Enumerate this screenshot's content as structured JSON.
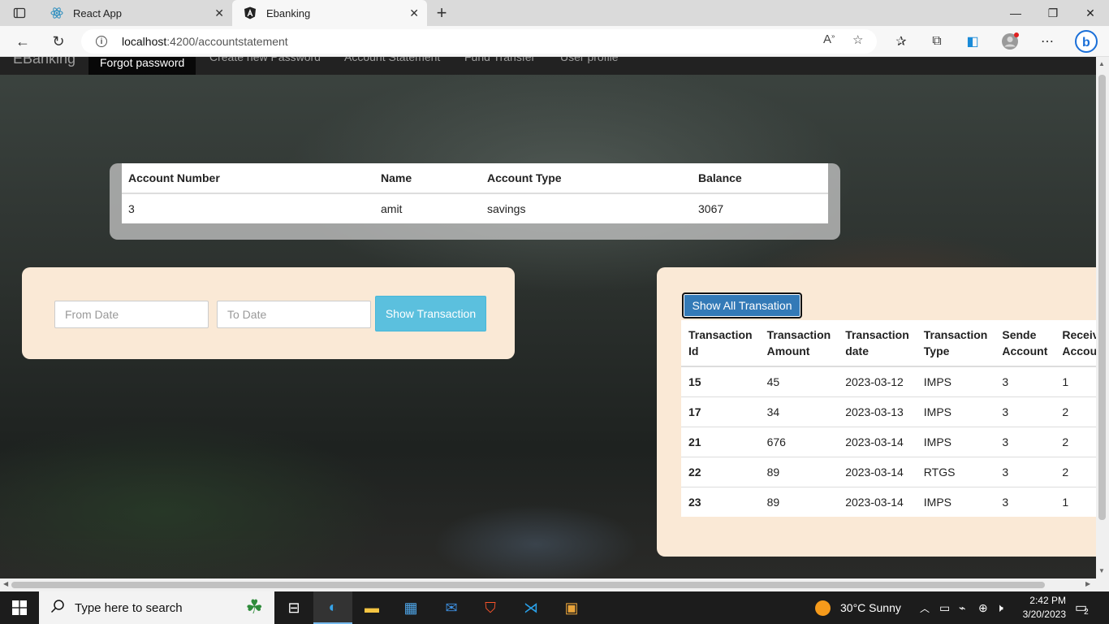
{
  "browser": {
    "tabs": [
      {
        "title": "React App",
        "icon": "react-icon",
        "active": false
      },
      {
        "title": "Ebanking",
        "icon": "angular-icon",
        "active": true
      }
    ],
    "url_host": "localhost",
    "url_path": ":4200/accountstatement"
  },
  "navbar": {
    "brand": "EBanking",
    "items": [
      "Forgot password",
      "Create new Password",
      "Account Statement",
      "Fund Transfer",
      "User profile"
    ]
  },
  "account": {
    "headers": [
      "Account Number",
      "Name",
      "Account Type",
      "Balance"
    ],
    "row": [
      "3",
      "amit",
      "savings",
      "3067"
    ]
  },
  "filter": {
    "from_placeholder": "From Date",
    "to_placeholder": "To Date",
    "show_label": "Show Transaction"
  },
  "transactions": {
    "show_all_label": "Show All Transation",
    "headers": [
      [
        "Transaction",
        "Id"
      ],
      [
        "Transaction",
        "Amount"
      ],
      [
        "Transaction",
        "date"
      ],
      [
        "Transaction",
        "Type"
      ],
      [
        "Sende",
        "Account"
      ],
      [
        "Receive",
        "Accoun"
      ]
    ],
    "rows": [
      [
        "15",
        "45",
        "2023-03-12",
        "IMPS",
        "3",
        "1"
      ],
      [
        "17",
        "34",
        "2023-03-13",
        "IMPS",
        "3",
        "2"
      ],
      [
        "21",
        "676",
        "2023-03-14",
        "IMPS",
        "3",
        "2"
      ],
      [
        "22",
        "89",
        "2023-03-14",
        "RTGS",
        "3",
        "2"
      ],
      [
        "23",
        "89",
        "2023-03-14",
        "IMPS",
        "3",
        "1"
      ]
    ]
  },
  "taskbar": {
    "search_placeholder": "Type here to search",
    "weather": "30°C  Sunny",
    "time": "2:42 PM",
    "date": "3/20/2023",
    "notifications": "2"
  },
  "colors": {
    "card_bg": "#fae9d6",
    "info_button": "#5bc0de",
    "primary_button": "#337ab7"
  }
}
